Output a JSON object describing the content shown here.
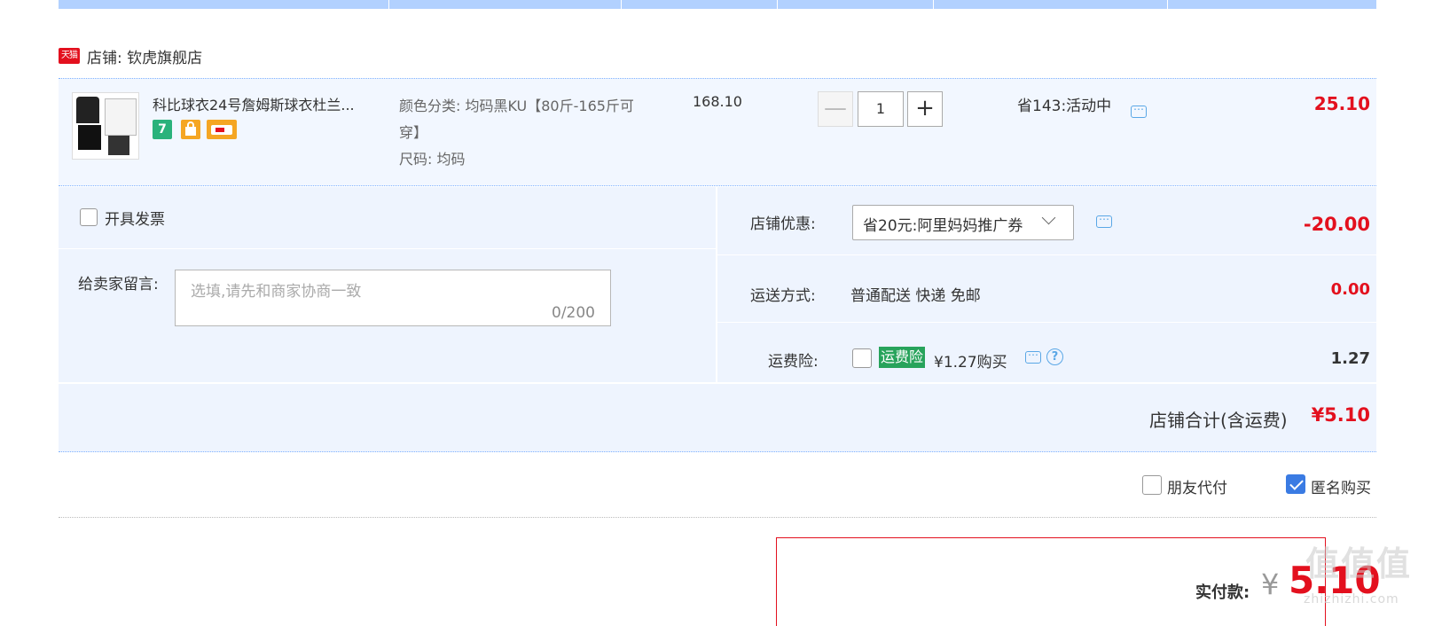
{
  "shop": {
    "platform_badge": "天猫",
    "label": "店铺: 钦虎旗舰店"
  },
  "item": {
    "title": "科比球衣24号詹姆斯球衣杜兰...",
    "badges": [
      "7",
      "bag-icon",
      "card-icon"
    ],
    "sku_color": "颜色分类: 均码黑KU【80斤-165斤可穿】",
    "sku_size": "尺码: 均码",
    "price": "168.10",
    "quantity": "1",
    "minus": "—",
    "plus": "+",
    "promo": "省143:活动中",
    "subtotal": "25.10"
  },
  "options": {
    "invoice_label": "开具发票",
    "message_label": "给卖家留言:",
    "message_placeholder": "选填,请先和商家协商一致",
    "message_count": "0/200",
    "shop_discount_label": "店铺优惠:",
    "shop_discount_selected": "省20元:阿里妈妈推广券",
    "shop_discount_amount": "-20.00",
    "shipping_label": "运送方式:",
    "shipping_value": "普通配送 快递 免邮",
    "shipping_amount": "0.00",
    "insurance_label": "运费险:",
    "insurance_tag": "运费险",
    "insurance_price": "¥1.27购买",
    "insurance_help": "?",
    "insurance_amount": "1.27"
  },
  "totals": {
    "shop_total_label": "店铺合计(含运费)",
    "shop_total_value": "¥5.10"
  },
  "payment": {
    "friend_pay_label": "朋友代付",
    "anonymous_label": "匿名购买",
    "anonymous_checked": true,
    "pay_label": "实付款:",
    "currency": "¥",
    "pay_amount": "5.10"
  },
  "watermark": {
    "main": "值值值",
    "sub": "zhizhizhi.com"
  },
  "colors": {
    "accent_red": "#e3101e",
    "row_bg": "#f2f7ff",
    "header_bar": "#b2d1ff",
    "insurance_green": "#27a35b",
    "checkbox_blue": "#3a7be3"
  }
}
